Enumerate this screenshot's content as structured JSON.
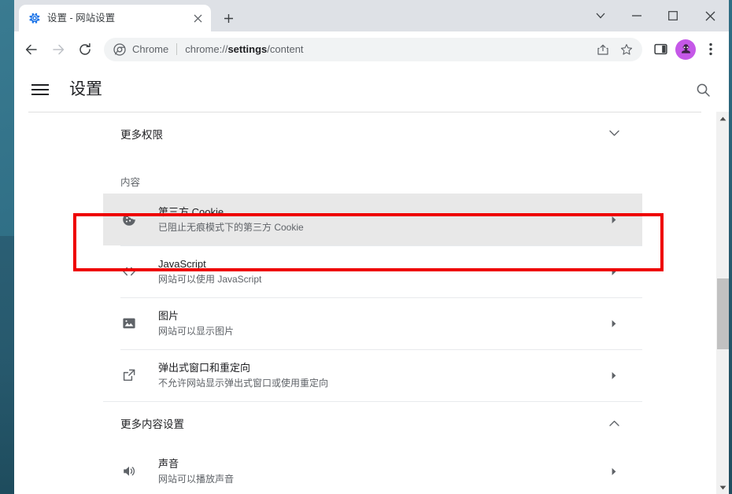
{
  "window": {
    "caption": {
      "collapse_label": "v",
      "minimize_label": "—",
      "maximize_label": "□",
      "close_label": "×"
    }
  },
  "tabstrip": {
    "tabs": [
      {
        "favicon": "settings-gear-icon",
        "title": "设置 - 网站设置",
        "close_label": "×",
        "active": true
      }
    ],
    "new_tab_label": "+"
  },
  "toolbar": {
    "back_label": "←",
    "forward_label": "→",
    "reload_label": "⟳",
    "omnibox": {
      "security_icon": "chrome-logo-icon",
      "chip_label": "Chrome",
      "url_prefix": "chrome://",
      "url_bold": "settings",
      "url_suffix": "/content",
      "full_url": "chrome://settings/content",
      "share_icon": "share-icon",
      "bookmark_icon": "star-icon"
    },
    "side_panel_icon": "side-panel-icon",
    "profile_icon": "profile-avatar-icon",
    "menu_icon": "three-dot-menu-icon"
  },
  "settings": {
    "menu_icon": "hamburger-menu-icon",
    "title": "设置",
    "search_icon": "search-icon",
    "collapsible_top": {
      "label": "更多权限",
      "state_icon": "chevron-down-icon",
      "expanded": false
    },
    "section_label": "内容",
    "content_rows": [
      {
        "icon": "cookie-icon",
        "title": "第三方 Cookie",
        "subtitle": "已阻止无痕模式下的第三方 Cookie",
        "arrow_icon": "chevron-right-icon",
        "selected": true
      },
      {
        "icon": "javascript-code-icon",
        "title": "JavaScript",
        "subtitle": "网站可以使用 JavaScript",
        "arrow_icon": "chevron-right-icon",
        "selected": false
      },
      {
        "icon": "image-icon",
        "title": "图片",
        "subtitle": "网站可以显示图片",
        "arrow_icon": "chevron-right-icon",
        "selected": false
      },
      {
        "icon": "popup-external-link-icon",
        "title": "弹出式窗口和重定向",
        "subtitle": "不允许网站显示弹出式窗口或使用重定向",
        "arrow_icon": "chevron-right-icon",
        "selected": false
      }
    ],
    "collapsible_more": {
      "label": "更多内容设置",
      "state_icon": "chevron-up-icon",
      "expanded": true
    },
    "more_rows": [
      {
        "icon": "sound-speaker-icon",
        "title": "声音",
        "subtitle": "网站可以播放声音",
        "arrow_icon": "chevron-right-icon",
        "selected": false
      }
    ]
  },
  "annotation": {
    "highlight_color": "#ee0000",
    "target": "第三方 Cookie"
  },
  "scrollbar": {
    "up_arrow": "scroll-up-arrow",
    "down_arrow": "scroll-down-arrow",
    "thumb": "scroll-thumb"
  }
}
